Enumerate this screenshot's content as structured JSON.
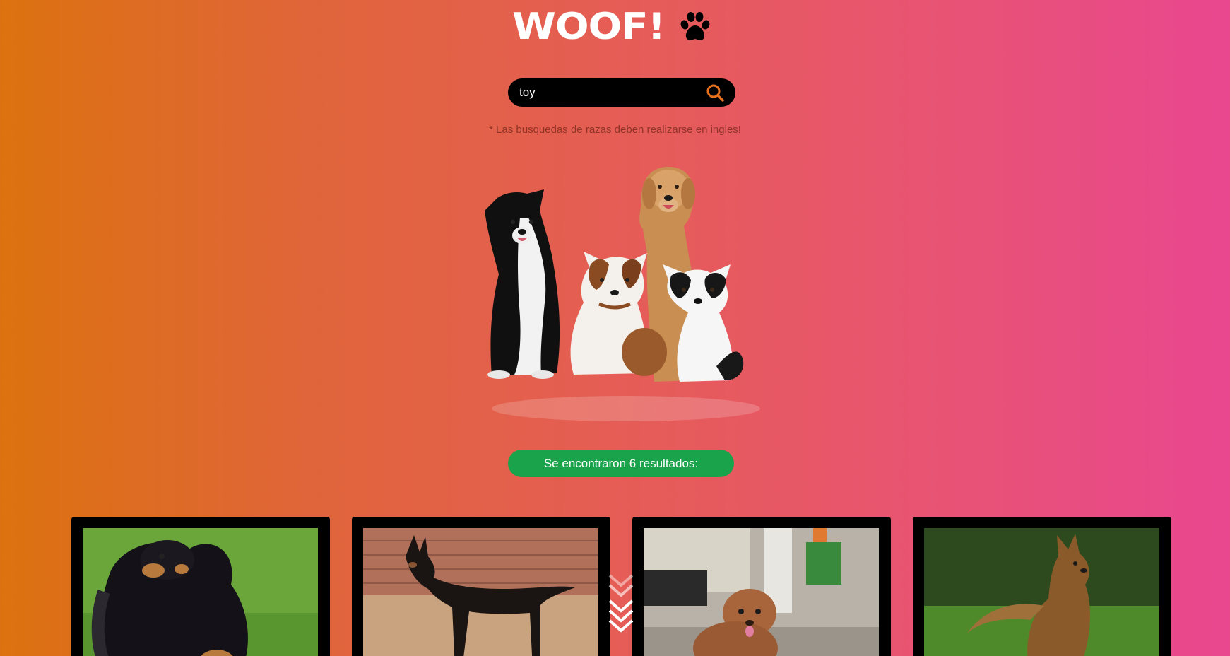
{
  "header": {
    "logo_text": "WOOF!",
    "logo_icon": "paw-icon"
  },
  "search": {
    "value": "toy",
    "placeholder": "",
    "button_icon": "search-icon"
  },
  "hint": "* Las busquedas de razas deben realizarse en ingles!",
  "results": {
    "label": "Se encontraron 6 resultados:",
    "count": 6
  },
  "cards": [
    {
      "breed_image": "dog-photo-spaniel"
    },
    {
      "breed_image": "dog-photo-pinscher"
    },
    {
      "breed_image": "dog-photo-poodle"
    },
    {
      "breed_image": "dog-photo-terrier"
    }
  ],
  "colors": {
    "gradient_start": "#dc720f",
    "gradient_end": "#e9478f",
    "search_bg": "#000000",
    "search_icon": "#e8711c",
    "badge_bg": "#1aa34a",
    "card_bg": "#000000"
  }
}
